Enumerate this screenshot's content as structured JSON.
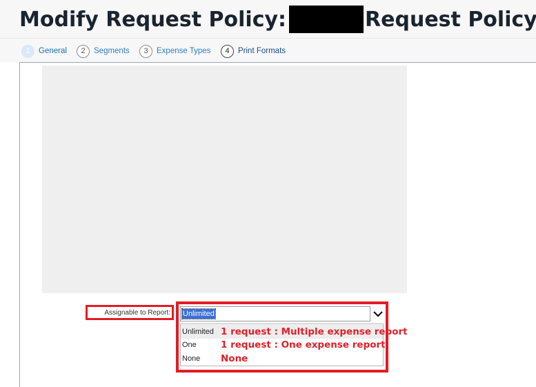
{
  "page": {
    "title_prefix": "Modify Request Policy:",
    "title_suffix": "Request Policy"
  },
  "steps": [
    {
      "number": "1",
      "label": "General",
      "active": true
    },
    {
      "number": "2",
      "label": "Segments",
      "active": false
    },
    {
      "number": "3",
      "label": "Expense Types",
      "active": false
    },
    {
      "number": "4",
      "label": "Print Formats",
      "active": false
    }
  ],
  "form": {
    "assignable_label": "Assignable to Report:",
    "assignable_value": "Unlimited",
    "options": [
      {
        "label": "Unlimited",
        "note": "1 request : Multiple expense report"
      },
      {
        "label": "One",
        "note": "1 request : One expense report"
      },
      {
        "label": "None",
        "note": "None"
      }
    ]
  },
  "colors": {
    "annotation_red": "#e31b23",
    "selected_blue": "#3b6fd6",
    "step_link_blue": "#2f7ec3"
  }
}
